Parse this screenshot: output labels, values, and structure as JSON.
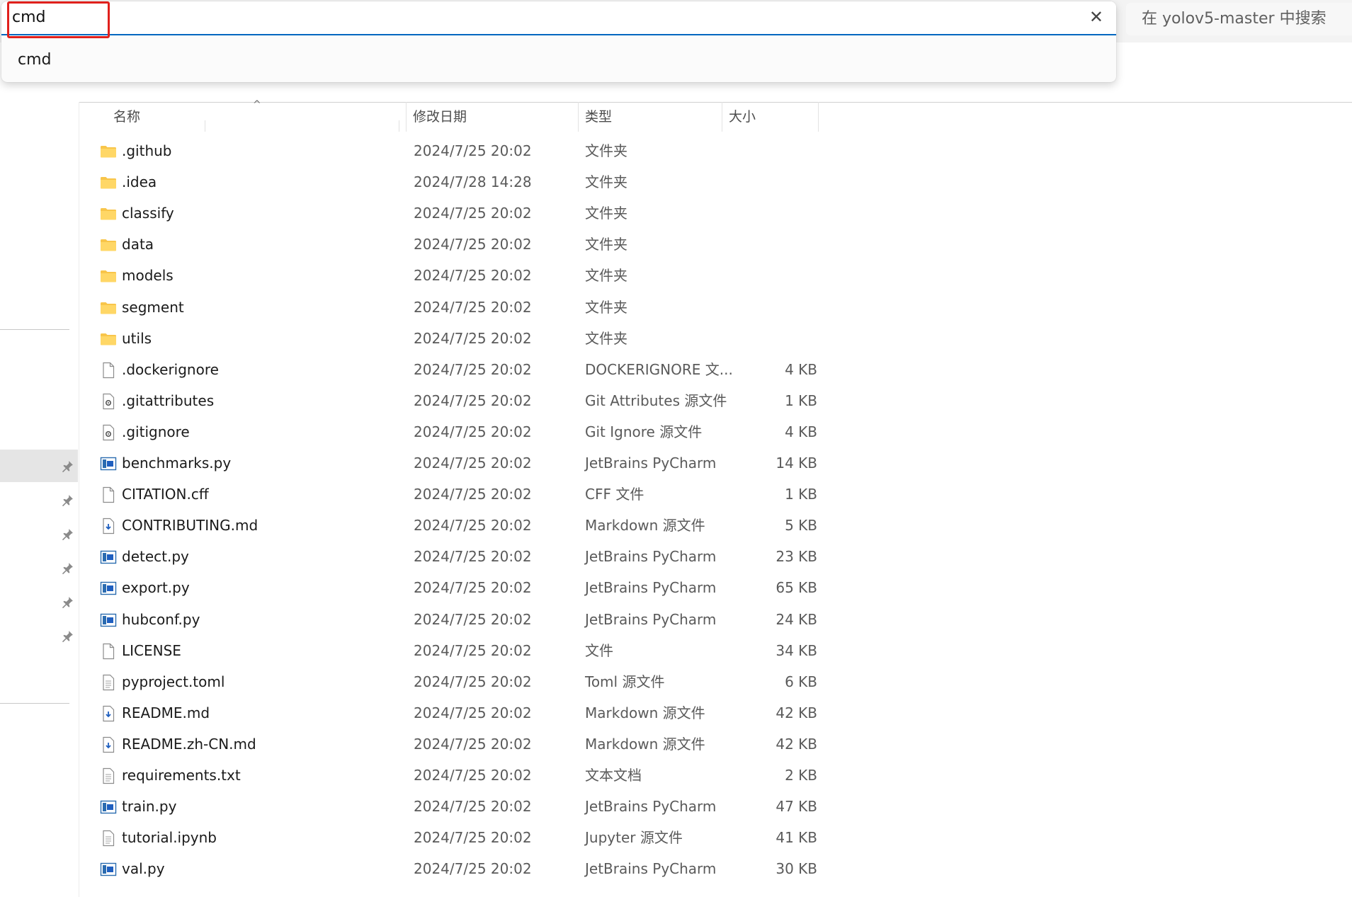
{
  "address_bar": {
    "input_value": "cmd",
    "suggestions": [
      "cmd"
    ]
  },
  "search": {
    "placeholder": "在 yolov5-master 中搜索"
  },
  "columns": {
    "name": "名称",
    "date": "修改日期",
    "type": "类型",
    "size": "大小"
  },
  "files": [
    {
      "name": ".github",
      "date": "2024/7/25 20:02",
      "type": "文件夹",
      "size": "",
      "icon": "folder-icon"
    },
    {
      "name": ".idea",
      "date": "2024/7/28 14:28",
      "type": "文件夹",
      "size": "",
      "icon": "folder-icon"
    },
    {
      "name": "classify",
      "date": "2024/7/25 20:02",
      "type": "文件夹",
      "size": "",
      "icon": "folder-icon"
    },
    {
      "name": "data",
      "date": "2024/7/25 20:02",
      "type": "文件夹",
      "size": "",
      "icon": "folder-icon"
    },
    {
      "name": "models",
      "date": "2024/7/25 20:02",
      "type": "文件夹",
      "size": "",
      "icon": "folder-icon"
    },
    {
      "name": "segment",
      "date": "2024/7/25 20:02",
      "type": "文件夹",
      "size": "",
      "icon": "folder-icon"
    },
    {
      "name": "utils",
      "date": "2024/7/25 20:02",
      "type": "文件夹",
      "size": "",
      "icon": "folder-icon"
    },
    {
      "name": ".dockerignore",
      "date": "2024/7/25 20:02",
      "type": "DOCKERIGNORE 文...",
      "size": "4 KB",
      "icon": "blank-file-icon"
    },
    {
      "name": ".gitattributes",
      "date": "2024/7/25 20:02",
      "type": "Git Attributes 源文件",
      "size": "1 KB",
      "icon": "config-file-icon"
    },
    {
      "name": ".gitignore",
      "date": "2024/7/25 20:02",
      "type": "Git Ignore 源文件",
      "size": "4 KB",
      "icon": "config-file-icon"
    },
    {
      "name": "benchmarks.py",
      "date": "2024/7/25 20:02",
      "type": "JetBrains PyCharm",
      "size": "14 KB",
      "icon": "pycharm-file-icon"
    },
    {
      "name": "CITATION.cff",
      "date": "2024/7/25 20:02",
      "type": "CFF 文件",
      "size": "1 KB",
      "icon": "blank-file-icon"
    },
    {
      "name": "CONTRIBUTING.md",
      "date": "2024/7/25 20:02",
      "type": "Markdown 源文件",
      "size": "5 KB",
      "icon": "markdown-file-icon"
    },
    {
      "name": "detect.py",
      "date": "2024/7/25 20:02",
      "type": "JetBrains PyCharm",
      "size": "23 KB",
      "icon": "pycharm-file-icon"
    },
    {
      "name": "export.py",
      "date": "2024/7/25 20:02",
      "type": "JetBrains PyCharm",
      "size": "65 KB",
      "icon": "pycharm-file-icon"
    },
    {
      "name": "hubconf.py",
      "date": "2024/7/25 20:02",
      "type": "JetBrains PyCharm",
      "size": "24 KB",
      "icon": "pycharm-file-icon"
    },
    {
      "name": "LICENSE",
      "date": "2024/7/25 20:02",
      "type": "文件",
      "size": "34 KB",
      "icon": "blank-file-icon"
    },
    {
      "name": "pyproject.toml",
      "date": "2024/7/25 20:02",
      "type": "Toml 源文件",
      "size": "6 KB",
      "icon": "text-file-icon"
    },
    {
      "name": "README.md",
      "date": "2024/7/25 20:02",
      "type": "Markdown 源文件",
      "size": "42 KB",
      "icon": "markdown-file-icon"
    },
    {
      "name": "README.zh-CN.md",
      "date": "2024/7/25 20:02",
      "type": "Markdown 源文件",
      "size": "42 KB",
      "icon": "markdown-file-icon"
    },
    {
      "name": "requirements.txt",
      "date": "2024/7/25 20:02",
      "type": "文本文档",
      "size": "2 KB",
      "icon": "text-file-icon"
    },
    {
      "name": "train.py",
      "date": "2024/7/25 20:02",
      "type": "JetBrains PyCharm",
      "size": "47 KB",
      "icon": "pycharm-file-icon"
    },
    {
      "name": "tutorial.ipynb",
      "date": "2024/7/25 20:02",
      "type": "Jupyter 源文件",
      "size": "41 KB",
      "icon": "text-file-icon"
    },
    {
      "name": "val.py",
      "date": "2024/7/25 20:02",
      "type": "JetBrains PyCharm",
      "size": "30 KB",
      "icon": "pycharm-file-icon"
    }
  ],
  "colors": {
    "accent": "#0067c0",
    "highlight_box": "#e0201c",
    "folder": "#f8c54a"
  }
}
